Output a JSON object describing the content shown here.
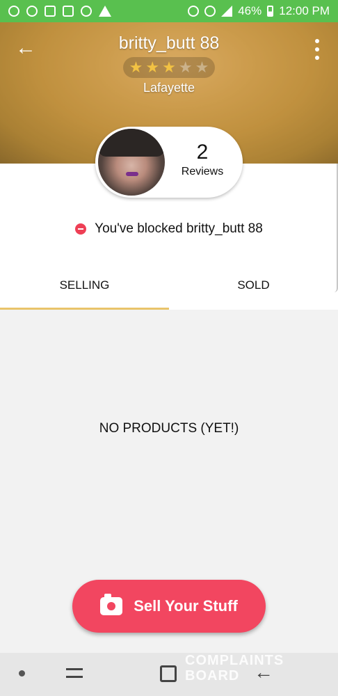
{
  "status_bar": {
    "battery": "46%",
    "time": "12:00 PM"
  },
  "header": {
    "username": "britty_butt 88",
    "rating": 3,
    "max_rating": 5,
    "location": "Lafayette"
  },
  "profile": {
    "review_count": "2",
    "reviews_label": "Reviews"
  },
  "blocked_message": "You've blocked britty_butt 88",
  "tabs": [
    {
      "label": "SELLING",
      "active": true
    },
    {
      "label": "SOLD",
      "active": false
    }
  ],
  "empty_state": "NO PRODUCTS (YET!)",
  "sell_button": {
    "label": "Sell Your Stuff"
  },
  "watermark": {
    "line1": "COMPLAINTS",
    "line2": "BOARD"
  },
  "colors": {
    "status_green": "#59c04f",
    "sell_red": "#f24660",
    "tab_accent": "#e9c46a",
    "blocked_red": "#ee3f55"
  }
}
